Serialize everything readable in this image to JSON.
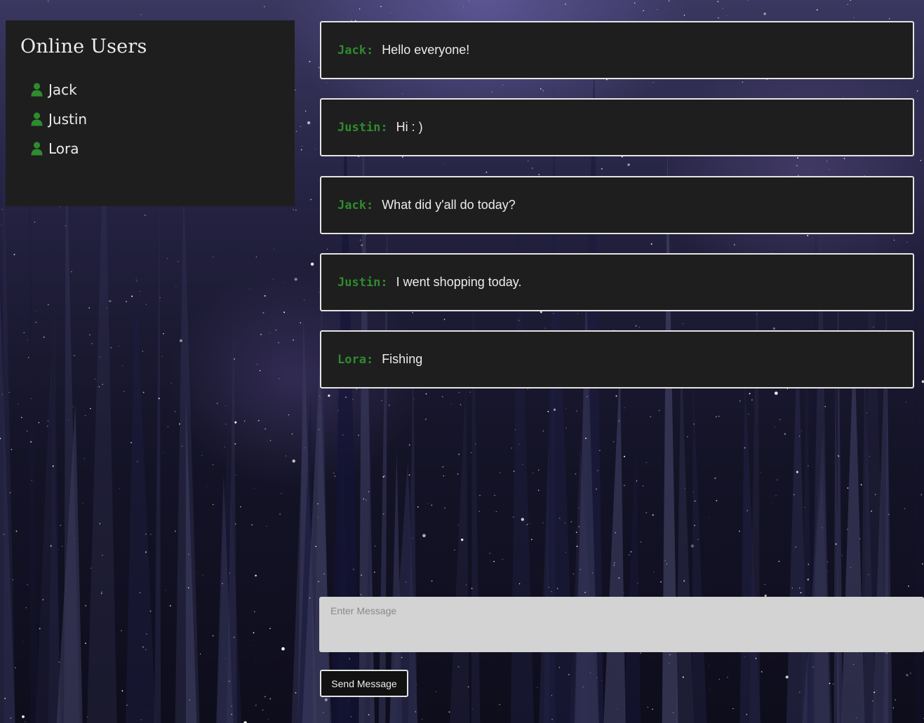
{
  "users_panel": {
    "title": "Online Users",
    "icon": "user-icon",
    "users": [
      "Jack",
      "Justin",
      "Lora"
    ]
  },
  "messages": [
    {
      "author": "Jack:",
      "text": "Hello everyone!"
    },
    {
      "author": "Justin:",
      "text": "Hi : )"
    },
    {
      "author": "Jack:",
      "text": "What did y'all do today?"
    },
    {
      "author": "Justin:",
      "text": "I went shopping today."
    },
    {
      "author": "Lora:",
      "text": "Fishing"
    }
  ],
  "composer": {
    "placeholder": "Enter Message",
    "value": "",
    "send_label": "Send Message"
  },
  "colors": {
    "accent_green": "#2e8b2e",
    "panel_bg": "#1e1e1e",
    "border": "#e4e4e4",
    "input_bg": "#d3d3d3"
  }
}
